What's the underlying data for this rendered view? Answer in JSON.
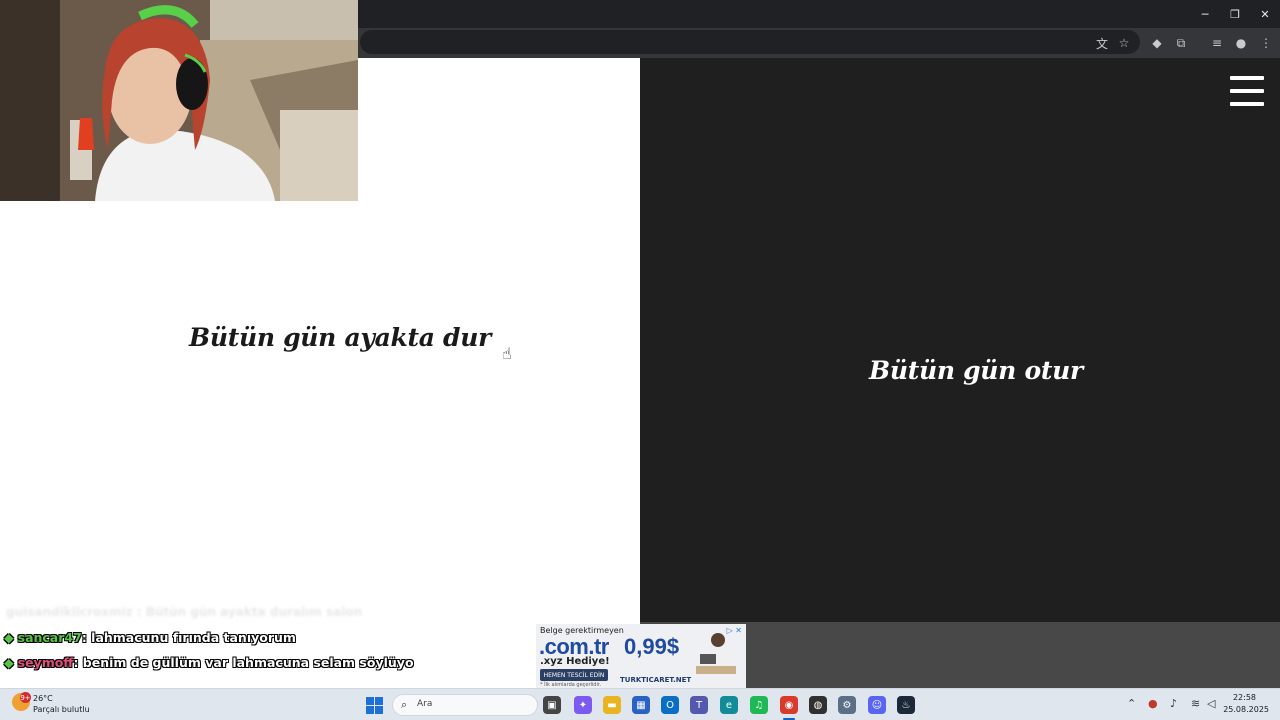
{
  "window_controls": {
    "minimize": "─",
    "restore": "❐",
    "close": "✕"
  },
  "toolbar": {
    "icons": [
      "translate-icon",
      "star-icon",
      "extension-diamond-icon",
      "puzzle-icon",
      "reading-list-icon",
      "profile-avatar-icon",
      "menu-kebab-icon"
    ],
    "glyphs": {
      "translate": "文",
      "star": "☆",
      "diamond": "◆",
      "puzzle": "⧉",
      "reading": "≡",
      "profile": "●",
      "menu": "⋮"
    }
  },
  "left_panel": {
    "text": "Bütün gün ayakta dur",
    "background": "#ffffff"
  },
  "right_panel": {
    "text": "Bütün gün otur",
    "background": "#1f1f1f"
  },
  "cursor": {
    "glyph": "☝"
  },
  "chat": {
    "faded": "guisandikilcroxmiz : Bütün gün ayakta duralım salon",
    "messages": [
      {
        "user": "sancar47",
        "text": ": lahmacunu fırında tanıyorum",
        "user_color": "#57c444"
      },
      {
        "user": "seymoff",
        "text": ": benim de güllüm var lahmacuna selam söylüyo",
        "user_color": "#e0507a"
      }
    ],
    "gem_glyph": "◆"
  },
  "ad": {
    "line1": "Belge gerektirmeyen",
    "domain": ".com.tr",
    "price": "0,99$",
    "sub": ".xyz Hediye!",
    "button": "HEMEN TESCİL EDİN",
    "note": "* İlk alımlarda geçerlidir.",
    "brand": "TURKTICARET.NET",
    "mark": "▷ ✕"
  },
  "taskbar": {
    "weather": {
      "temp": "26°C",
      "condition": "Parçalı bulutlu",
      "badge": "9+"
    },
    "search_placeholder": "Ara",
    "search_glyph": "⌕",
    "apps": [
      {
        "name": "task-view-icon",
        "glyph": "▣",
        "color": "#444444"
      },
      {
        "name": "copilot-icon",
        "glyph": "✦",
        "color": "#7a5af0"
      },
      {
        "name": "file-explorer-icon",
        "glyph": "▬",
        "color": "#e8b420"
      },
      {
        "name": "store-icon",
        "glyph": "▦",
        "color": "#2a62c4"
      },
      {
        "name": "outlook-icon",
        "glyph": "O",
        "color": "#0a6fc4"
      },
      {
        "name": "teams-icon",
        "glyph": "T",
        "color": "#5558af"
      },
      {
        "name": "edge-icon",
        "glyph": "e",
        "color": "#138c9a"
      },
      {
        "name": "spotify-icon",
        "glyph": "♫",
        "color": "#1db954"
      },
      {
        "name": "chrome-icon",
        "glyph": "◉",
        "color": "#d93b2b"
      },
      {
        "name": "obs-icon",
        "glyph": "◍",
        "color": "#303030"
      },
      {
        "name": "settings-icon",
        "glyph": "⚙",
        "color": "#5b6f86"
      },
      {
        "name": "discord-icon",
        "glyph": "☺",
        "color": "#5865f2"
      },
      {
        "name": "steam-icon",
        "glyph": "♨",
        "color": "#1b2838"
      }
    ],
    "tray_glyphs": {
      "chevron": "⌃",
      "record": "●",
      "mic": "♪",
      "wifi": "≋",
      "volume": "◁"
    },
    "time": "22:58",
    "date": "25.08.2025"
  }
}
